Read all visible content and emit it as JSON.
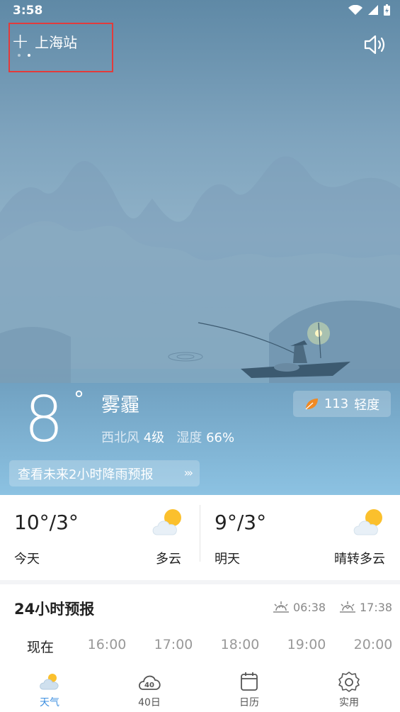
{
  "status_bar": {
    "time": "3:58"
  },
  "header": {
    "plus": "+",
    "city": "上海站"
  },
  "current": {
    "temperature": "8",
    "degree": "°",
    "condition": "雾霾",
    "wind_label": "西北风",
    "wind_value": "4级",
    "humidity_label": "湿度",
    "humidity_value": "66%",
    "aqi_value": "113",
    "aqi_level": "轻度",
    "rain_forecast_label": "查看未来2小时降雨预报"
  },
  "daily": [
    {
      "range": "10°/3°",
      "label": "今天",
      "desc": "多云",
      "icon": "partly-cloudy-icon"
    },
    {
      "range": "9°/3°",
      "label": "明天",
      "desc": "晴转多云",
      "icon": "partly-cloudy-icon"
    }
  ],
  "hourly": {
    "title": "24小时预报",
    "sunrise": "06:38",
    "sunset": "17:38",
    "hours": [
      "现在",
      "16:00",
      "17:00",
      "18:00",
      "19:00",
      "20:00"
    ]
  },
  "tabs": [
    {
      "label": "天气",
      "icon": "weather-icon"
    },
    {
      "label": "40日",
      "icon": "forty-day-icon"
    },
    {
      "label": "日历",
      "icon": "calendar-icon"
    },
    {
      "label": "实用",
      "icon": "settings-icon"
    }
  ],
  "colors": {
    "accent": "#3d8fe0",
    "highlight": "#e23b3b",
    "aqi_leaf": "#f08a24"
  }
}
